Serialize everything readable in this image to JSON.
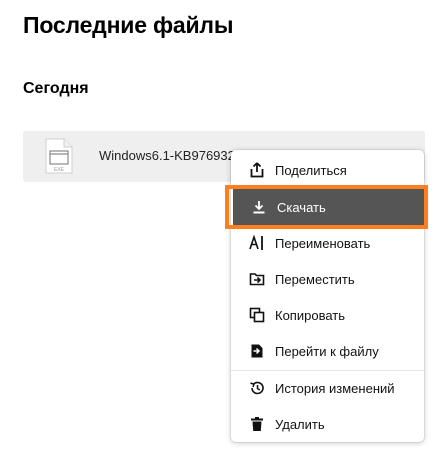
{
  "page": {
    "title": "Последние файлы"
  },
  "section": {
    "title": "Сегодня"
  },
  "file": {
    "name": "Windows6.1-KB976932",
    "type_badge": "EXE"
  },
  "context_menu": {
    "items": [
      {
        "label": "Поделиться",
        "icon": "share-icon"
      },
      {
        "label": "Скачать",
        "icon": "download-icon",
        "active": true
      },
      {
        "label": "Переименовать",
        "icon": "rename-icon"
      },
      {
        "label": "Переместить",
        "icon": "move-icon"
      },
      {
        "label": "Копировать",
        "icon": "copy-icon"
      },
      {
        "label": "Перейти к файлу",
        "icon": "go-to-file-icon"
      },
      {
        "label": "История изменений",
        "icon": "history-icon"
      },
      {
        "label": "Удалить",
        "icon": "trash-icon"
      }
    ]
  },
  "colors": {
    "active_item_bg": "#555555",
    "highlight_outline": "#ff7f1f",
    "file_row_bg": "#efefef"
  }
}
